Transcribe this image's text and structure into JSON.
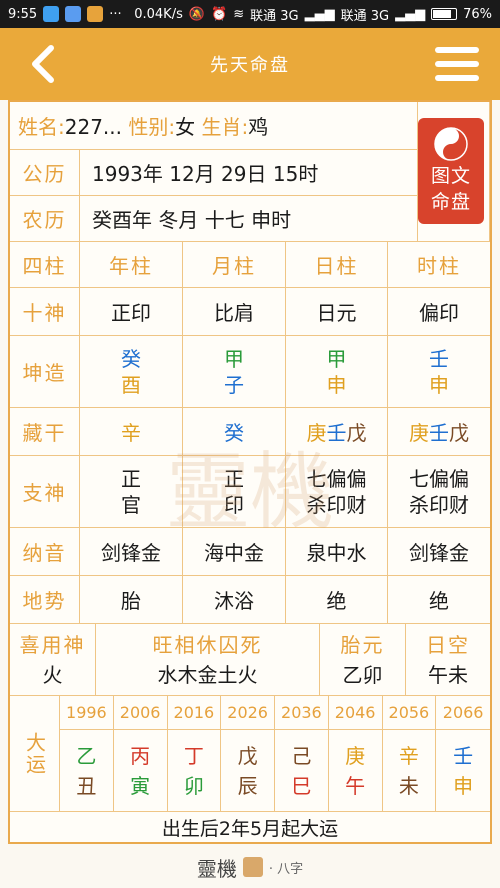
{
  "status": {
    "time": "9:55",
    "speed": "0.04K/s",
    "carrier1": "联通 3G",
    "carrier2": "联通 3G",
    "battery": "76%"
  },
  "header": {
    "title": "先天命盘"
  },
  "colors": {
    "accent": "#eaa93a",
    "label": "#e6a13c",
    "wood": "#2a9b3a",
    "fire": "#d43a2a",
    "earth": "#7a4a25",
    "metal": "#e0a020",
    "water": "#1f6fd0"
  },
  "badge": {
    "line1": "图文",
    "line2": "命盘"
  },
  "info": {
    "name_label": "姓名:",
    "name": "227...",
    "gender_label": "性别:",
    "gender": "女",
    "zodiac_label": "生肖:",
    "zodiac": "鸡",
    "solar_label": "公历",
    "solar": "1993年 12月 29日 15时",
    "lunar_label": "农历",
    "lunar": "癸酉年 冬月 十七 申时"
  },
  "pillars": {
    "header_label": "四柱",
    "columns": [
      "年柱",
      "月柱",
      "日柱",
      "时柱"
    ],
    "rows": [
      {
        "label": "十神",
        "values": [
          "正印",
          "比肩",
          "日元",
          "偏印"
        ]
      },
      {
        "label": "坤造",
        "stems": [
          "癸",
          "甲",
          "甲",
          "壬"
        ],
        "branches": [
          "酉",
          "子",
          "申",
          "申"
        ]
      },
      {
        "label": "藏干",
        "hidden": [
          [
            "辛"
          ],
          [
            "癸"
          ],
          [
            "庚",
            "壬",
            "戊"
          ],
          [
            "庚",
            "壬",
            "戊"
          ]
        ]
      },
      {
        "label": "支神",
        "spirits": [
          [
            "正",
            "官"
          ],
          [
            "正",
            "印"
          ],
          [
            "七偏偏",
            "杀印财"
          ],
          [
            "七偏偏",
            "杀印财"
          ]
        ]
      },
      {
        "label": "纳音",
        "values": [
          "剑锋金",
          "海中金",
          "泉中水",
          "剑锋金"
        ]
      },
      {
        "label": "地势",
        "values": [
          "胎",
          "沐浴",
          "绝",
          "绝"
        ]
      }
    ]
  },
  "summary": {
    "xiyong_label": "喜用神",
    "xiyong": "火",
    "wangxiang_label": "旺相休囚死",
    "wangxiang": "水木金土火",
    "taiyuan_label": "胎元",
    "taiyuan": "乙卯",
    "rikong_label": "日空",
    "rikong": "午未"
  },
  "dayun": {
    "label": "大运",
    "years": [
      "1996",
      "2006",
      "2016",
      "2026",
      "2036",
      "2046",
      "2056",
      "2066"
    ],
    "stems": [
      "乙",
      "丙",
      "丁",
      "戊",
      "己",
      "庚",
      "辛",
      "壬"
    ],
    "branches": [
      "丑",
      "寅",
      "卯",
      "辰",
      "巳",
      "午",
      "未",
      "申"
    ],
    "note": "出生后2年5月起大运"
  },
  "watermark": "靈機",
  "footer": {
    "logo": "靈機",
    "sub": "· 八字"
  }
}
